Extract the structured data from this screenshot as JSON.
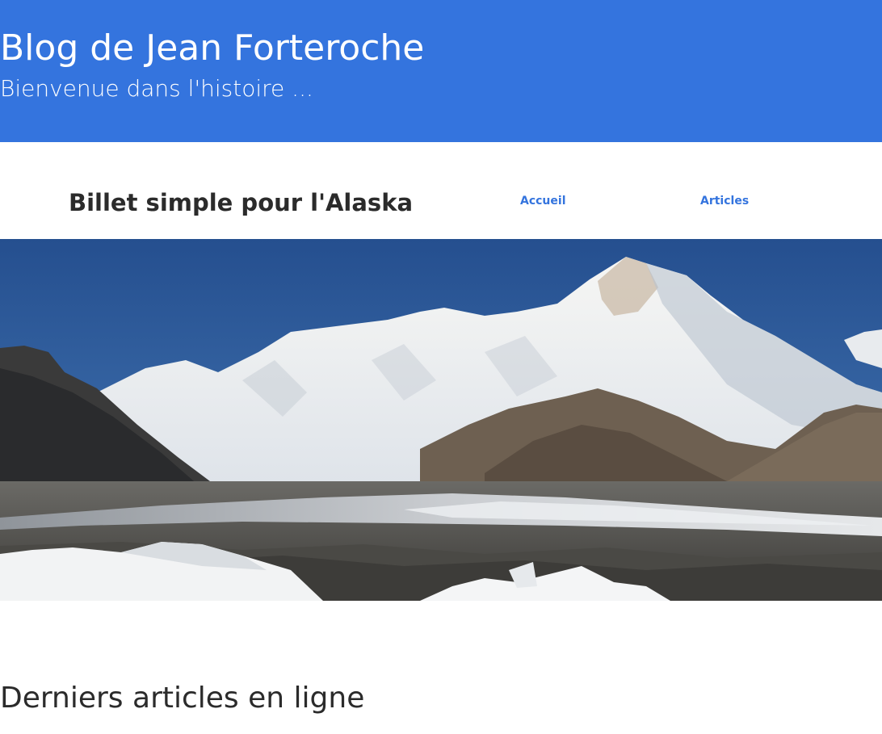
{
  "header": {
    "title": "Blog de Jean Forteroche",
    "subtitle": "Bienvenue dans l'histoire ..."
  },
  "navbar": {
    "brand": "Billet simple pour l'Alaska",
    "links": [
      {
        "label": "Accueil"
      },
      {
        "label": "Articles"
      }
    ]
  },
  "hero": {
    "image_subject": "snowy-mountain-glacier-landscape"
  },
  "main": {
    "section_title": "Derniers articles en ligne"
  },
  "colors": {
    "header_bg": "#3474de",
    "link": "#3474de",
    "text": "#2b2b2b"
  }
}
